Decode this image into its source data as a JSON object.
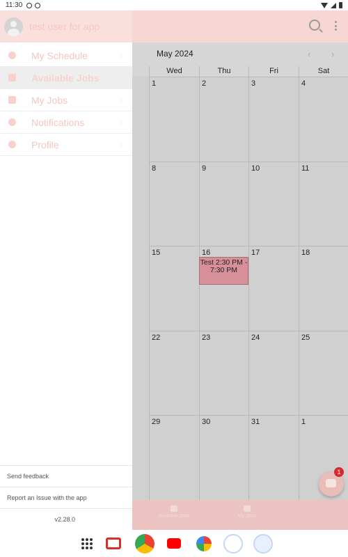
{
  "status_bar": {
    "time": "11:30"
  },
  "app_bar": {
    "search_icon": "search-icon",
    "more_icon": "more-vert-icon"
  },
  "calendar": {
    "month_label": "May 2024",
    "prev_icon": "chevron-left-icon",
    "next_icon": "chevron-right-icon",
    "weekday_headers": [
      "Wed",
      "Thu",
      "Fri",
      "Sat"
    ],
    "weeks": [
      [
        "1",
        "2",
        "3",
        "4"
      ],
      [
        "8",
        "9",
        "10",
        "11"
      ],
      [
        "15",
        "16",
        "17",
        "18"
      ],
      [
        "22",
        "23",
        "24",
        "25"
      ],
      [
        "29",
        "30",
        "31",
        "1"
      ]
    ],
    "event": {
      "label": "Test 2:30 PM - 7:30 PM",
      "color": "#d7909a"
    }
  },
  "bottom_tabs": [
    {
      "label": "Available Jobs",
      "icon": "available-jobs-icon"
    },
    {
      "label": "My Jobs",
      "icon": "briefcase-icon"
    }
  ],
  "fab": {
    "badge": "1",
    "icon": "chat-icon"
  },
  "drawer": {
    "user_name": "test user for app",
    "items": [
      {
        "label": "My Schedule",
        "icon": "clock-icon",
        "active": false
      },
      {
        "label": "Available Jobs",
        "icon": "jobs-list-icon",
        "active": true
      },
      {
        "label": "My Jobs",
        "icon": "briefcase-icon",
        "active": false
      },
      {
        "label": "Notifications",
        "icon": "bell-icon",
        "active": false
      },
      {
        "label": "Profile",
        "icon": "person-icon",
        "active": false
      }
    ],
    "footer": {
      "send_feedback": "Send feedback",
      "report_issue": "Report an Issue with the app",
      "version": "v2.28.0"
    }
  },
  "nav_bar": {
    "apps": [
      "app-drawer-icon",
      "gmail-icon",
      "chrome-icon",
      "youtube-icon",
      "photos-icon",
      "phone-icon",
      "messages-icon"
    ]
  },
  "colors": {
    "brand_pink": "#f7d6d3",
    "event_pink": "#d7909a",
    "badge_red": "#d42b2b"
  }
}
